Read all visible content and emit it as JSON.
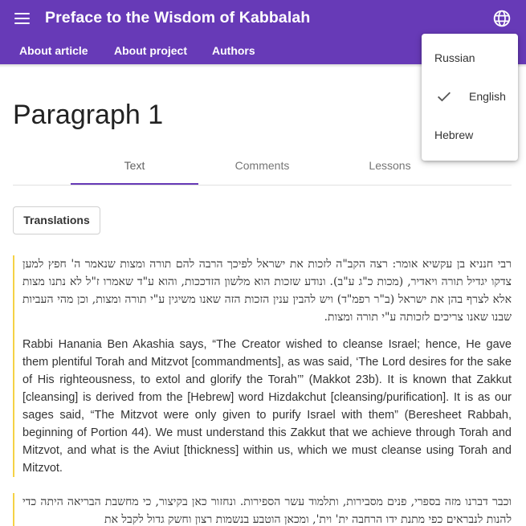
{
  "app": {
    "title": "Preface to the Wisdom of Kabbalah",
    "menu_icon": "menu-icon",
    "language_icon": "globe-icon",
    "accent_color": "#673ab7"
  },
  "nav": {
    "items": [
      "About article",
      "About project",
      "Authors"
    ]
  },
  "language_menu": {
    "items": [
      {
        "label": "Russian",
        "selected": false
      },
      {
        "label": "English",
        "selected": true
      },
      {
        "label": "Hebrew",
        "selected": false
      }
    ],
    "check_icon": "check-icon"
  },
  "main": {
    "title": "Paragraph 1",
    "tabs": [
      {
        "label": "Text",
        "active": true
      },
      {
        "label": "Comments",
        "active": false
      },
      {
        "label": "Lessons",
        "active": false
      }
    ],
    "translations_button": "Translations",
    "paragraphs": [
      {
        "hebrew": "רבי חנניא בן עקשיא אומר: רצה הקב\"ה לזכות את ישראל לפיכך הרבה להם תורה ומצות שנאמר ה' חפץ למען צדקו יגדיל תורה ויאדיר, (מכות כ\"ג ע\"ב). ונודע שזכות הוא מלשון הזדככות, והוא ע\"ד שאמרו ז\"ל לא נתנו מצות אלא לצרף בהן את ישראל (ב\"ר רפמ\"ד) ויש להבין ענין הזכות הזה שאנו משיגין ע\"י תורה ומצות, וכן מהי העביות שבנו שאנו צריכים לזכותה ע\"י תורה ומצות.",
        "english": "Rabbi Hanania Ben Akashia says, “The Creator wished to cleanse Israel; hence, He gave them plentiful Torah and Mitzvot [commandments], as was said, ‘The Lord desires for the sake of His righteousness, to extol and glorify the Torah’” (Makkot 23b). It is known that Zakkut [cleansing] is derived from the [Hebrew] word Hizdakchut [cleansing/purification]. It is as our sages said, “The Mitzvot were only given to purify Israel with them” (Beresheet Rabbah, beginning of Portion 44). We must understand this Zakkut that we achieve through Torah and Mitzvot, and what is the Aviut [thickness] within us, which we must cleanse using Torah and Mitzvot."
      },
      {
        "hebrew": "וכבר דברנו מזה בספרי, פנים מסבירות, ותלמוד עשר הספירות. ונחזור כאן בקיצור, כי מחשבת הבריאה היתה כדי להנות לנבראים כפי מתנת ידו הרחבה ית' וית', ומכאן הוטבע בנשמות רצון וחשק גדול לקבל את"
      }
    ]
  }
}
